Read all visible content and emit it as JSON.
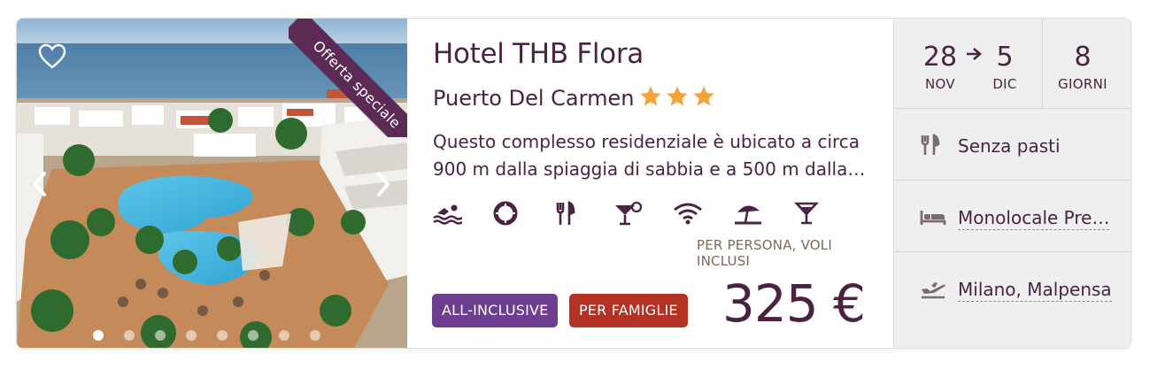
{
  "photo": {
    "ribbon_text": "Offerta speciale",
    "dots_count": 8,
    "active_dot": 0
  },
  "hotel": {
    "name": "Hotel THB Flora",
    "location": "Puerto Del Carmen",
    "stars": 3,
    "description": "Questo complesso residenziale è ubicato a circa 900 m dalla spiaggia di sabbia e a 500 m dalla…",
    "amenities": [
      "swimming-icon",
      "lifebuoy-icon",
      "restaurant-icon",
      "cocktail-icon",
      "wifi-icon",
      "beach-umbrella-icon",
      "martini-icon"
    ]
  },
  "price": {
    "label": "PER PERSONA, VOLI INCLUSI",
    "value": "325 €"
  },
  "badges": {
    "all_inclusive": "ALL-INCLUSIVE",
    "family": "PER FAMIGLIE"
  },
  "dates": {
    "start_day": "28",
    "start_month": "NOV",
    "end_day": "5",
    "end_month": "DIC",
    "days": "8",
    "days_label": "GIORNI"
  },
  "details": {
    "board": "Senza pasti",
    "room": "Monolocale Pre…",
    "departure": "Milano, Malpensa"
  },
  "colors": {
    "primary": "#4a2343",
    "ribbon": "#5c2b55",
    "star": "#f4a338",
    "badge_all_inclusive": "#6d3d90",
    "badge_family": "#b33224",
    "side_bg": "#efefef"
  }
}
